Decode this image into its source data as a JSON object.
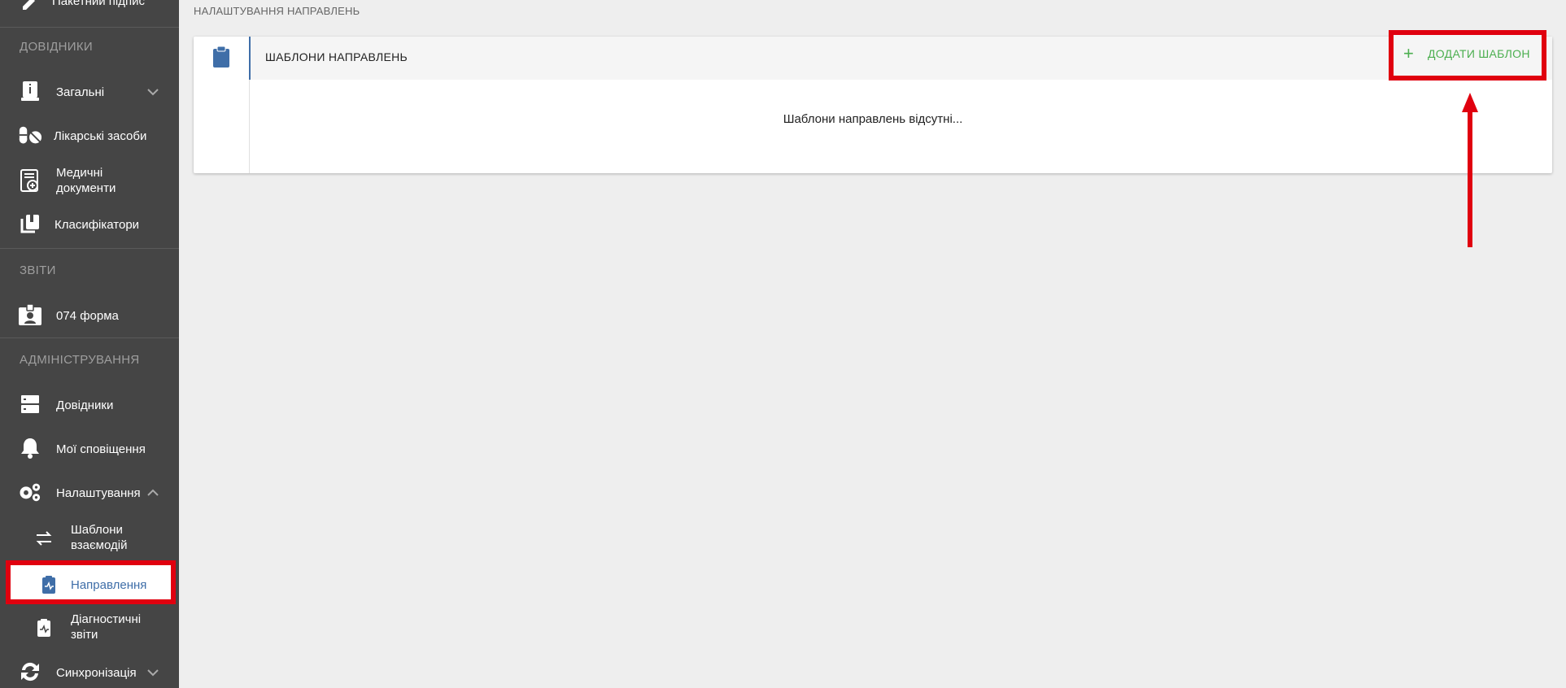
{
  "sidebar": {
    "top_cut_item": "Пакетний підпис",
    "sections": {
      "references": "ДОВІДНИКИ",
      "reports": "ЗВІТИ",
      "admin": "АДМІНІСТРУВАННЯ"
    },
    "items": {
      "general": "Загальні",
      "medicines": "Лікарські засоби",
      "medical_docs": "Медичні документи",
      "classifiers": "Класифікатори",
      "form074": "074 форма",
      "directories": "Довідники",
      "notifications": "Мої сповіщення",
      "settings": "Налаштування",
      "interaction_templates": "Шаблони взаємодій",
      "referrals": "Направлення",
      "diagnostic_reports": "Діагностичні звіти",
      "sync": "Синхронізація"
    }
  },
  "main": {
    "page_title": "НАЛАШТУВАННЯ НАПРАВЛЕНЬ",
    "card_title": "ШАБЛОНИ НАПРАВЛЕНЬ",
    "add_button": "ДОДАТИ ШАБЛОН",
    "empty_message": "Шаблони направлень відсутні..."
  },
  "colors": {
    "sidebar_bg": "#454545",
    "accent_blue": "#3f6ea8",
    "accent_green": "#4caf50",
    "highlight_red": "#e0000f"
  }
}
